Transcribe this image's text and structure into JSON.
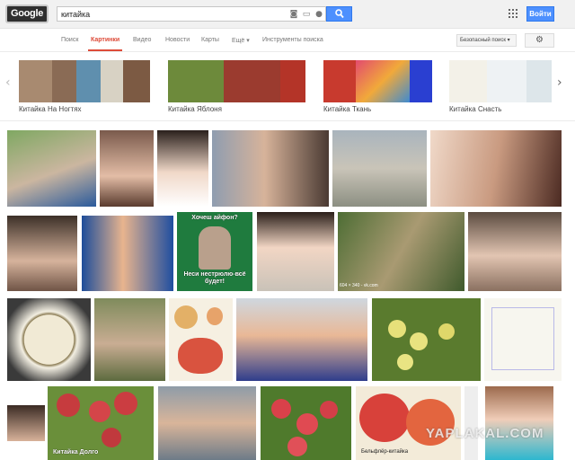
{
  "header": {
    "logo_text": "Google",
    "search_query": "китайка",
    "login_label": "Войти"
  },
  "nav": {
    "tabs": [
      {
        "label": "Поиск"
      },
      {
        "label": "Картинки"
      },
      {
        "label": "Видео"
      },
      {
        "label": "Новости"
      },
      {
        "label": "Карты"
      },
      {
        "label": "Ещё ▾"
      },
      {
        "label": "Инструменты поиска"
      }
    ],
    "active_tab": "Картинки",
    "safe_search_label": "Безопасный поиск ▾"
  },
  "related": [
    {
      "label": "Китайка На Ногтях"
    },
    {
      "label": "Китайка Яблоня"
    },
    {
      "label": "Китайка Ткань"
    },
    {
      "label": "Китайка Снасть"
    }
  ],
  "images": {
    "meme_top": "Хочеш айфон?",
    "meme_bottom": "Неси нестрюлю-всё будет!",
    "size_info": "604 × 340 - vk.com",
    "apple_caption": "Бельфлёр-китайка",
    "tile_caption": "Китайка Долго",
    "watermark": "YAPLAKAL.COM"
  },
  "icons": {
    "search": "search-icon",
    "apps": "apps-grid-icon",
    "settings": "gear-icon",
    "camera": "camera-icon",
    "keyboard": "keyboard-icon",
    "mic": "microphone-icon",
    "prev": "chevron-left-icon",
    "next": "chevron-right-icon"
  },
  "colors": {
    "accent_red": "#dd4b39",
    "button_blue": "#4d90fe"
  }
}
